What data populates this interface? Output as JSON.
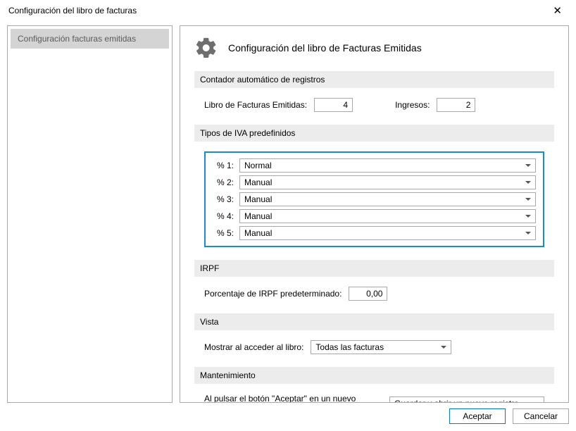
{
  "window": {
    "title": "Configuración del libro de facturas"
  },
  "sidebar": {
    "items": [
      {
        "label": "Configuración facturas emitidas"
      }
    ]
  },
  "header": {
    "title": "Configuración del libro de Facturas Emitidas"
  },
  "sections": {
    "contador": {
      "title": "Contador automático de registros",
      "libro_label": "Libro de Facturas Emitidas:",
      "libro_value": "4",
      "ingresos_label": "Ingresos:",
      "ingresos_value": "2"
    },
    "iva": {
      "title": "Tipos de IVA predefinidos",
      "rows": [
        {
          "label": "% 1:",
          "value": "Normal"
        },
        {
          "label": "% 2:",
          "value": "Manual"
        },
        {
          "label": "% 3:",
          "value": "Manual"
        },
        {
          "label": "% 4:",
          "value": "Manual"
        },
        {
          "label": "% 5:",
          "value": "Manual"
        }
      ]
    },
    "irpf": {
      "title": "IRPF",
      "label": "Porcentaje de IRPF predeterminado:",
      "value": "0,00"
    },
    "vista": {
      "title": "Vista",
      "label": "Mostrar al acceder al libro:",
      "value": "Todas las facturas"
    },
    "mantenimiento": {
      "title": "Mantenimiento",
      "label": "Al pulsar el botón \"Aceptar\" en un nuevo registro:",
      "value": "Guardar y abrir un nuevo registro"
    }
  },
  "buttons": {
    "accept": "Aceptar",
    "cancel": "Cancelar"
  }
}
